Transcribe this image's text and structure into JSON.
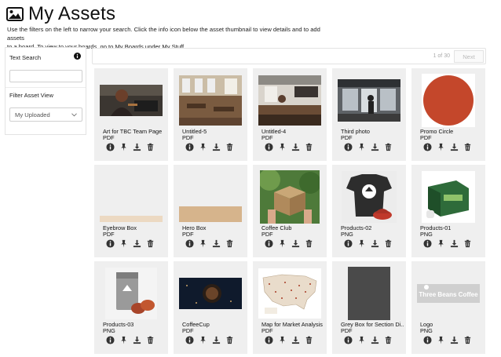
{
  "header": {
    "title": "My Assets",
    "icon": "image-icon"
  },
  "intro": {
    "line1": "Use the filters on the left to narrow your search. Click the info icon below the asset thumbnail to view details and to add assets",
    "line2": "to a board. To view to your boards, go to My Boards under My Stuff."
  },
  "sidebar": {
    "text_search_label": "Text Search",
    "text_search_value": "",
    "filter_label": "Filter Asset View",
    "filter_selected": "My Uploaded"
  },
  "pager": {
    "count": "1 of 30",
    "next_label": "Next"
  },
  "colors": {
    "card_bg": "#efefef",
    "icon": "#333333",
    "promo_circle": "#c4472b",
    "hero_box": "#d6b48c",
    "eyebrow_box": "#ecd9c2",
    "grey_box": "#4a4a4a",
    "coffee_cup_bg": "#0f1a2c"
  },
  "assets": [
    {
      "title": "Art for TBC Team Page",
      "type": "PDF",
      "thumb": "photo-woman-laptop"
    },
    {
      "title": "Untitled-5",
      "type": "PDF",
      "thumb": "photo-cafe-interior"
    },
    {
      "title": "Untitled-4",
      "type": "PDF",
      "thumb": "photo-cafe-bar"
    },
    {
      "title": "Third photo",
      "type": "PDF",
      "thumb": "photo-cafe-entrance"
    },
    {
      "title": "Promo Circle",
      "type": "PDF",
      "thumb": "orange-circle"
    },
    {
      "title": "Eyebrow Box",
      "type": "PDF",
      "thumb": "beige-strip"
    },
    {
      "title": "Hero Box",
      "type": "PDF",
      "thumb": "tan-box"
    },
    {
      "title": "Coffee Club",
      "type": "PDF",
      "thumb": "photo-box-hands"
    },
    {
      "title": "Products-02",
      "type": "PNG",
      "thumb": "tshirt-cap"
    },
    {
      "title": "Products-01",
      "type": "PNG",
      "thumb": "green-product-box"
    },
    {
      "title": "Products-03",
      "type": "PNG",
      "thumb": "coffee-bag-cups"
    },
    {
      "title": "CoffeeCup",
      "type": "PDF",
      "thumb": "coffee-cup-dark"
    },
    {
      "title": "Map for Market Analysis",
      "type": "PDF",
      "thumb": "us-map"
    },
    {
      "title": "Grey Box for Section Di...",
      "type": "PDF",
      "thumb": "grey-box"
    },
    {
      "title": "Logo",
      "type": "PNG",
      "thumb": "three-beans-logo",
      "thumb_text": "Three Beans Coffee"
    }
  ],
  "action_icons": [
    "info-icon",
    "pin-icon",
    "download-icon",
    "trash-icon"
  ]
}
